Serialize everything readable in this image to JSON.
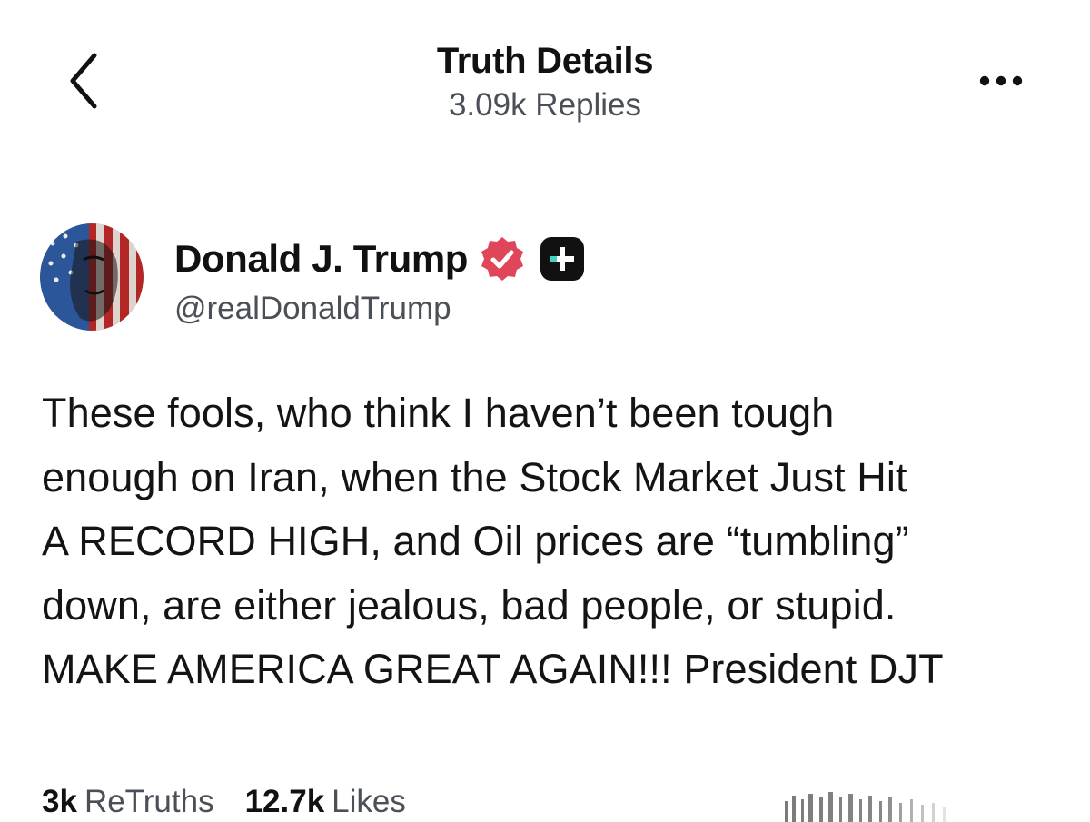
{
  "header": {
    "title": "Truth Details",
    "subtitle": "3.09k Replies",
    "back_icon": "chevron-left-icon",
    "more_icon": "more-horizontal-icon"
  },
  "author": {
    "name": "Donald J. Trump",
    "handle": "@realDonaldTrump",
    "verified_icon": "verified-badge-icon",
    "verified_color": "#e0465a",
    "plus_icon": "truth-plus-badge-icon"
  },
  "post": {
    "lines": [
      "These fools, who think I haven’t been tough",
      "enough on Iran, when the Stock Market Just Hit",
      "A RECORD HIGH, and Oil prices are “tumbling”",
      "down, are either jealous, bad people, or stupid.",
      "MAKE AMERICA GREAT AGAIN!!! President DJT"
    ]
  },
  "stats": {
    "retruths_count": "3k",
    "retruths_label": "ReTruths",
    "likes_count": "12.7k",
    "likes_label": "Likes"
  },
  "colors": {
    "text_primary": "#111111",
    "text_secondary": "#4b4f57",
    "background": "#ffffff"
  }
}
